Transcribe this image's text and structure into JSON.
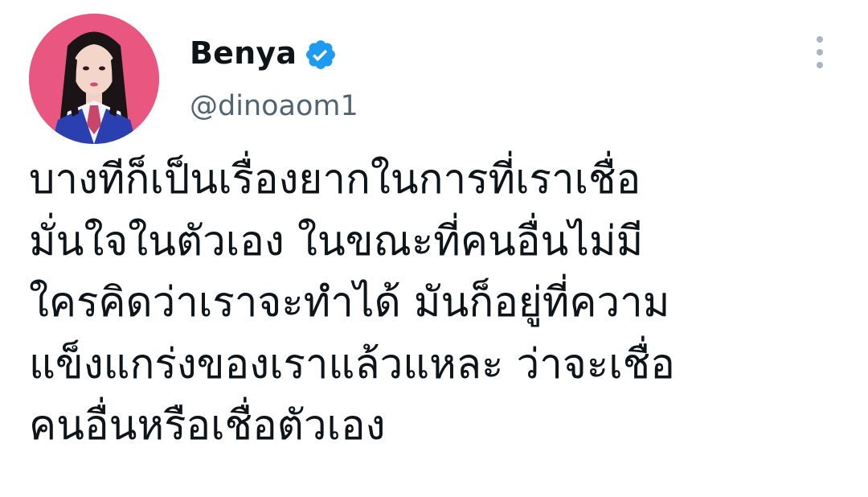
{
  "tweet": {
    "author": {
      "display_name": "Benya",
      "handle": "@dinoaom1",
      "verified": true,
      "verified_icon": "verified-badge-icon",
      "avatar_icon": "profile-photo"
    },
    "more_icon": "more-vertical-icon",
    "text_lines": [
      "บางทีก็เป็นเรื่องยากในการที่เราเชื่อ",
      "มั่นใจในตัวเอง ในขณะที่คนอื่นไม่มี",
      "ใครคิดว่าเราจะทำได้ มันก็อยู่ที่ความ",
      "แข็งแกร่งของเราแล้วแหละ ว่าจะเชื่อ",
      "คนอื่นหรือเชื่อตัวเอง"
    ]
  },
  "colors": {
    "verified_blue": "#1d9bf0",
    "avatar_background": "#e9567f",
    "handle_gray": "#536471",
    "text": "#0f1419"
  }
}
